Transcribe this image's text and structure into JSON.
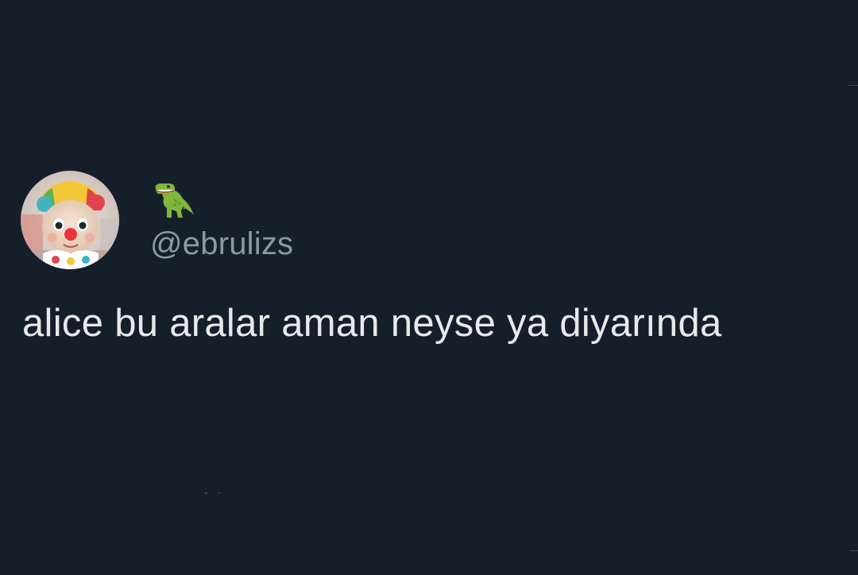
{
  "tweet": {
    "display_name_icon": "t-rex-emoji",
    "handle": "@ebrulizs",
    "text": "alice bu aralar aman neyse ya diyarında",
    "avatar": "clown-figure-avatar"
  },
  "colors": {
    "background": "#151f2a",
    "handle": "#8b98a5",
    "text": "#e7e9ea"
  }
}
